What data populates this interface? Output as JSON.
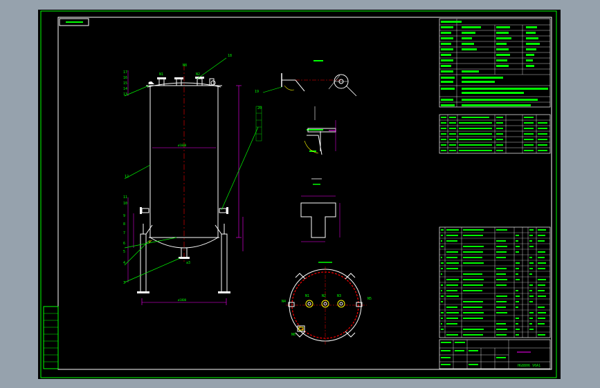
{
  "title_block": {
    "project_code": "HG8806 V0A1"
  },
  "nozzle_labels": {
    "n1": "N1",
    "n2": "N2",
    "n3": "N3",
    "n4": "N4",
    "n5": "N5",
    "n6": "N6",
    "n8": "N8",
    "a3": "a3"
  },
  "leader_numbers": {
    "top_right": "18",
    "right_mid": "19",
    "right_upper": "20",
    "left_shell": "12",
    "left_stack_top": [
      "17",
      "16",
      "15",
      "14",
      "13"
    ],
    "left_lower": [
      "11",
      "10",
      "9",
      "8",
      "7",
      "6",
      "5",
      "4",
      "3"
    ]
  },
  "colors": {
    "frame": "#00ff00",
    "line": "#ffffff",
    "text": "#00ff00",
    "accent": "#ff00ff",
    "yellow": "#ffff00",
    "red": "#ff0000",
    "cyan": "#00ffff"
  }
}
